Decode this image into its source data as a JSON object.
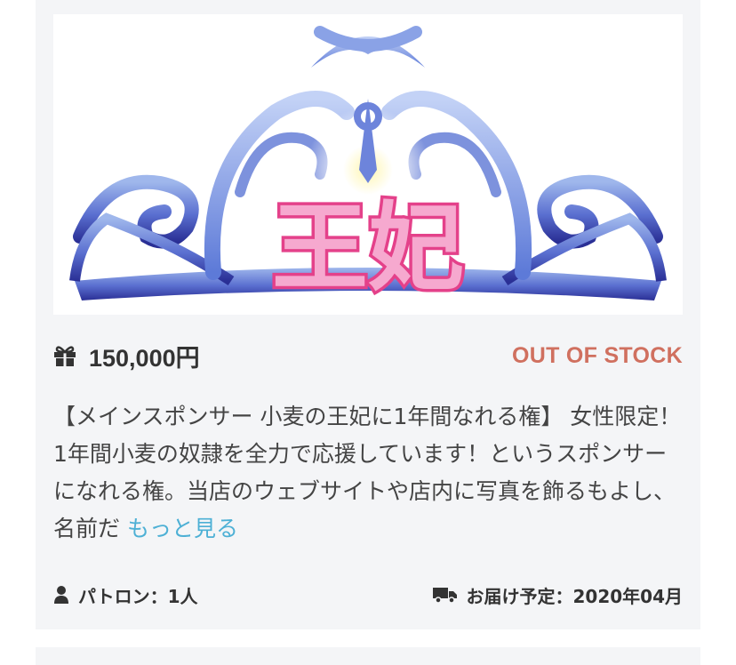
{
  "product": {
    "image_title": "王妃",
    "image_alt": "crown-with-queen-title",
    "price": "150,000円",
    "stock_status": "OUT OF STOCK",
    "description": "【メインスポンサー 小麦の王妃に1年間なれる権】 女性限定！ 1年間小麦の奴隷を全力で応援しています！というスポンサーになれる権。当店のウェブサイトや店内に写真を飾るもよし、名前だ",
    "read_more": "もっと見る",
    "patron_label": "パトロン：1人",
    "delivery_label": "お届け予定：2020年04月"
  },
  "icons": {
    "price": "gift-icon",
    "patron": "user-icon",
    "delivery": "truck-icon"
  },
  "colors": {
    "card_background": "#f4f5f7",
    "stock_status": "#d0705f",
    "read_more": "#4db0d5",
    "title_pink": "#f0589a"
  }
}
